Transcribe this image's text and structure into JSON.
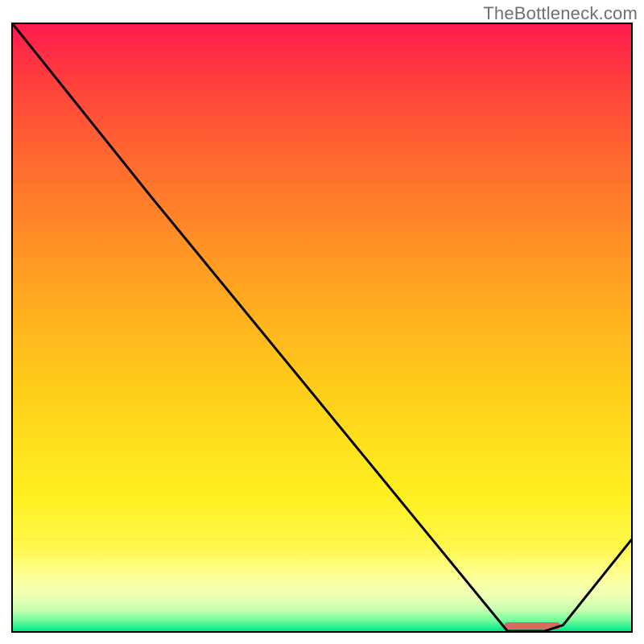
{
  "attribution": "TheBottleneck.com",
  "chart_data": {
    "type": "line",
    "title": "",
    "xlabel": "",
    "ylabel": "",
    "xlim": [
      0,
      100
    ],
    "ylim": [
      0,
      100
    ],
    "series": [
      {
        "name": "curve",
        "x": [
          0,
          22,
          80,
          83,
          86,
          89,
          100
        ],
        "y": [
          100,
          72,
          0,
          0,
          0,
          1,
          15
        ],
        "color": "#000000"
      }
    ],
    "overlay_segment": {
      "name": "highlight",
      "x_start": 79.5,
      "x_end": 88.5,
      "y": 0.8,
      "color": "#d96a62"
    },
    "background_gradient": {
      "orientation": "vertical",
      "stops": [
        {
          "pos": 0.0,
          "color": "#ff1a4d"
        },
        {
          "pos": 0.08,
          "color": "#ff3a3f"
        },
        {
          "pos": 0.18,
          "color": "#ff5c33"
        },
        {
          "pos": 0.28,
          "color": "#ff7a2b"
        },
        {
          "pos": 0.38,
          "color": "#ff9624"
        },
        {
          "pos": 0.48,
          "color": "#ffb11e"
        },
        {
          "pos": 0.58,
          "color": "#ffc81a"
        },
        {
          "pos": 0.68,
          "color": "#ffde1c"
        },
        {
          "pos": 0.78,
          "color": "#fff022"
        },
        {
          "pos": 0.86,
          "color": "#fff84a"
        },
        {
          "pos": 0.91,
          "color": "#feff99"
        },
        {
          "pos": 0.94,
          "color": "#f1ffb5"
        },
        {
          "pos": 0.965,
          "color": "#c7ffb1"
        },
        {
          "pos": 0.98,
          "color": "#7fff9e"
        },
        {
          "pos": 1.0,
          "color": "#00e78a"
        }
      ]
    }
  }
}
